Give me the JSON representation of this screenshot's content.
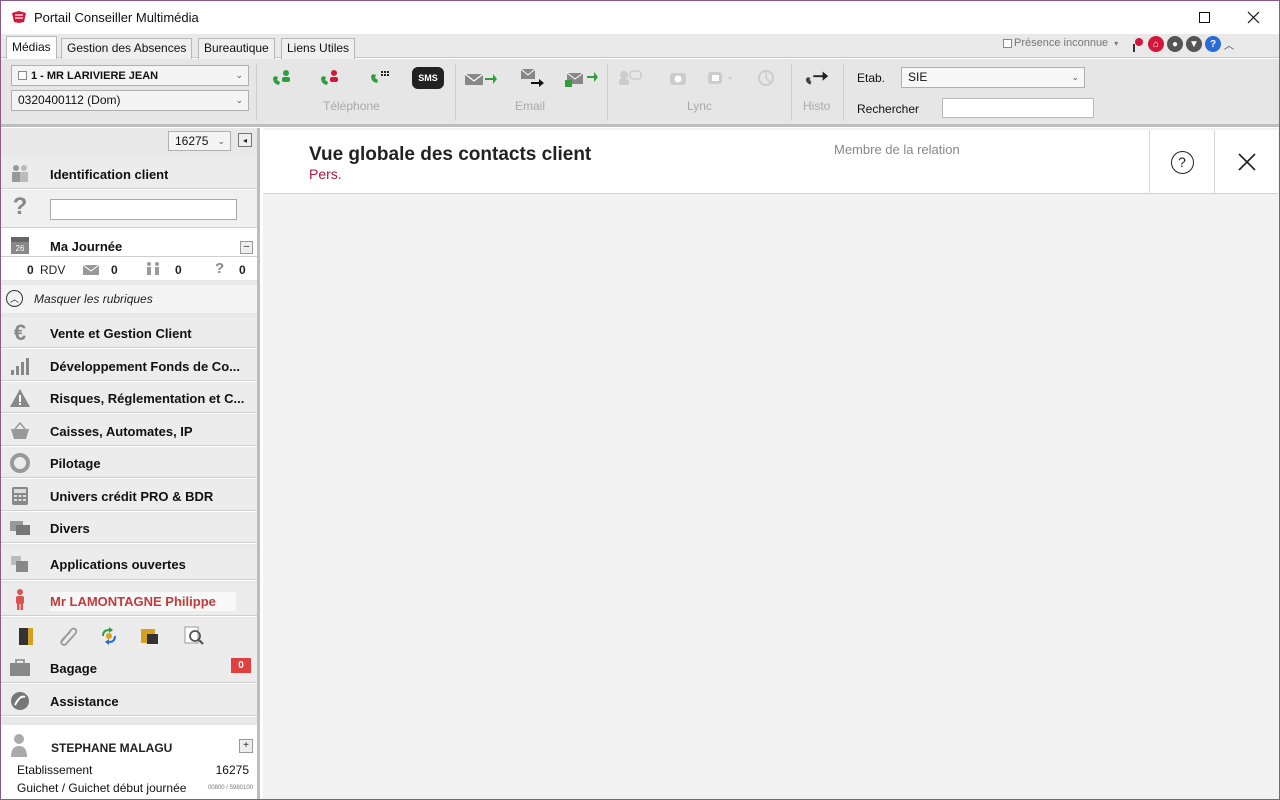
{
  "window": {
    "title": "Portail Conseiller Multimédia"
  },
  "tabs": [
    "Médias",
    "Gestion des Absences",
    "Bureautique",
    "Liens Utiles"
  ],
  "presence": {
    "label": "Présence inconnue"
  },
  "ribbon": {
    "contact_select": "1 - MR LARIVIERE JEAN",
    "phone_select": "0320400112 (Dom)",
    "sms_label": "SMS",
    "groups": {
      "telephone": "Téléphone",
      "email": "Email",
      "lync": "Lync",
      "histo": "Histo"
    },
    "etab_label": "Etab.",
    "etab_value": "SIE",
    "search_label": "Rechercher",
    "search_value": ""
  },
  "sidebar": {
    "agency": "16275",
    "identification": "Identification client",
    "question_mark": "?",
    "ma_journee": "Ma Journée",
    "calendar_day": "26",
    "stats": {
      "rdv_count": "0",
      "rdv_label": "RDV",
      "mail_count": "0",
      "people_count": "0",
      "question_count": "0"
    },
    "masquer": "Masquer les rubriques",
    "items": [
      "Vente et Gestion Client",
      "Développement Fonds de Co...",
      "Risques, Réglementation et C...",
      "Caisses, Automates, IP",
      "Pilotage",
      "Univers crédit PRO & BDR",
      "Divers"
    ],
    "applications": "Applications ouvertes",
    "client": "Mr LAMONTAGNE Philippe",
    "bagage": "Bagage",
    "bagage_count": "0",
    "assistance": "Assistance",
    "user": {
      "name": "STEPHANE MALAGU",
      "etab_label": "Etablissement",
      "etab_value": "16275",
      "guichet_label": "Guichet / Guichet début journée",
      "guichet_value": "00800 / 5980100"
    }
  },
  "main": {
    "title": "Vue globale des contacts client",
    "subtitle": "Pers.",
    "member_label": "Membre de la relation"
  },
  "colors": {
    "accent_red": "#b0183a",
    "client_red": "#c23b3b",
    "green_icon": "#2f9e3f"
  }
}
